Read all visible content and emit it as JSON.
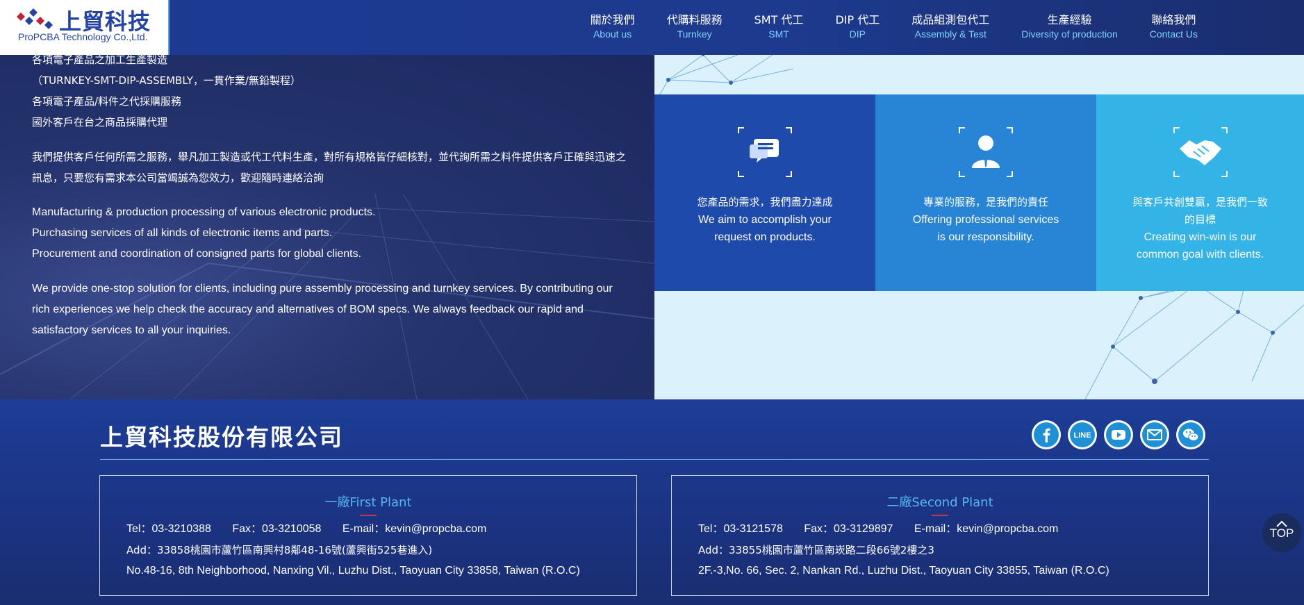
{
  "header": {
    "logo_cn": "上貿科技",
    "logo_en": "ProPCBA Technology Co.,Ltd.",
    "nav": [
      {
        "cn": "關於我們",
        "en": "About us"
      },
      {
        "cn": "代購料服務",
        "en": "Turnkey"
      },
      {
        "cn": "SMT 代工",
        "en": "SMT"
      },
      {
        "cn": "DIP 代工",
        "en": "DIP"
      },
      {
        "cn": "成品組測包代工",
        "en": "Assembly & Test"
      },
      {
        "cn": "生產經驗",
        "en": "Diversity of production"
      },
      {
        "cn": "聯絡我們",
        "en": "Contact Us"
      }
    ]
  },
  "intro": {
    "lines_cn": [
      "各項電子產品之加工生產製造",
      "（TURNKEY-SMT-DIP-ASSEMBLY，一貫作業/無鉛製程）",
      "各項電子產品/料件之代採購服務",
      "國外客戶在台之商品採購代理"
    ],
    "para_cn": "我們提供客戶任何所需之服務，舉凡加工製造或代工代料生產，對所有規格皆仔細核對，並代詢所需之料件提供客戶正確與迅速之訊息，只要您有需求本公司當竭誠為您效力，歡迎隨時連絡洽詢",
    "lines_en": [
      "Manufacturing & production processing of various electronic products.",
      "Purchasing services of all kinds of electronic items and parts.",
      "Procurement and coordination of consigned parts for global clients."
    ],
    "para_en": "We provide one-stop solution for clients, including pure assembly processing and turnkey services. By contributing our rich experiences we help check the accuracy and alternatives of BOM specs. We always feedback our rapid and satisfactory services to all your inquiries."
  },
  "cards": [
    {
      "icon": "chat-icon",
      "cn": "您產品的需求，我們盡力達成",
      "en": "We aim to accomplish your request on products."
    },
    {
      "icon": "person-icon",
      "cn": "專業的服務，是我們的責任",
      "en": "Offering professional services is our responsibility."
    },
    {
      "icon": "handshake-icon",
      "cn": "與客戶共創雙贏，是我們一致的目標",
      "en": "Creating win-win is our common goal with clients."
    }
  ],
  "footer": {
    "company": "上貿科技股份有限公司",
    "social": [
      "facebook-icon",
      "line-icon",
      "youtube-icon",
      "mail-icon",
      "wechat-icon"
    ],
    "line_label": "LINE",
    "plants": [
      {
        "title": "一廠First Plant",
        "tel": "Tel：03-3210388",
        "fax": "Fax：03-3210058",
        "email": "E-mail：kevin@propcba.com",
        "add_cn": "Add：33858桃園市蘆竹區南興村8鄰48-16號(蘆興街525巷進入)",
        "add_en": "No.48-16, 8th Neighborhood, Nanxing Vil., Luzhu Dist., Taoyuan City 33858, Taiwan (R.O.C)"
      },
      {
        "title": "二廠Second Plant",
        "tel": "Tel：03-3121578",
        "fax": "Fax：03-3129897",
        "email": "E-mail：kevin@propcba.com",
        "add_cn": "Add：33855桃園市蘆竹區南崁路二段66號2樓之3",
        "add_en": "2F.-3,No. 66, Sec. 2, Nankan Rd., Luzhu Dist., Taoyuan City 33855, Taiwan (R.O.C)"
      }
    ],
    "top_label": "TOP"
  },
  "colors": {
    "header_bg": "#1c3a93",
    "card1": "#1e4bab",
    "card2": "#2884d4",
    "card3": "#33b3e6",
    "footer_bg": "#1d3d97",
    "accent": "#55b7f0"
  }
}
